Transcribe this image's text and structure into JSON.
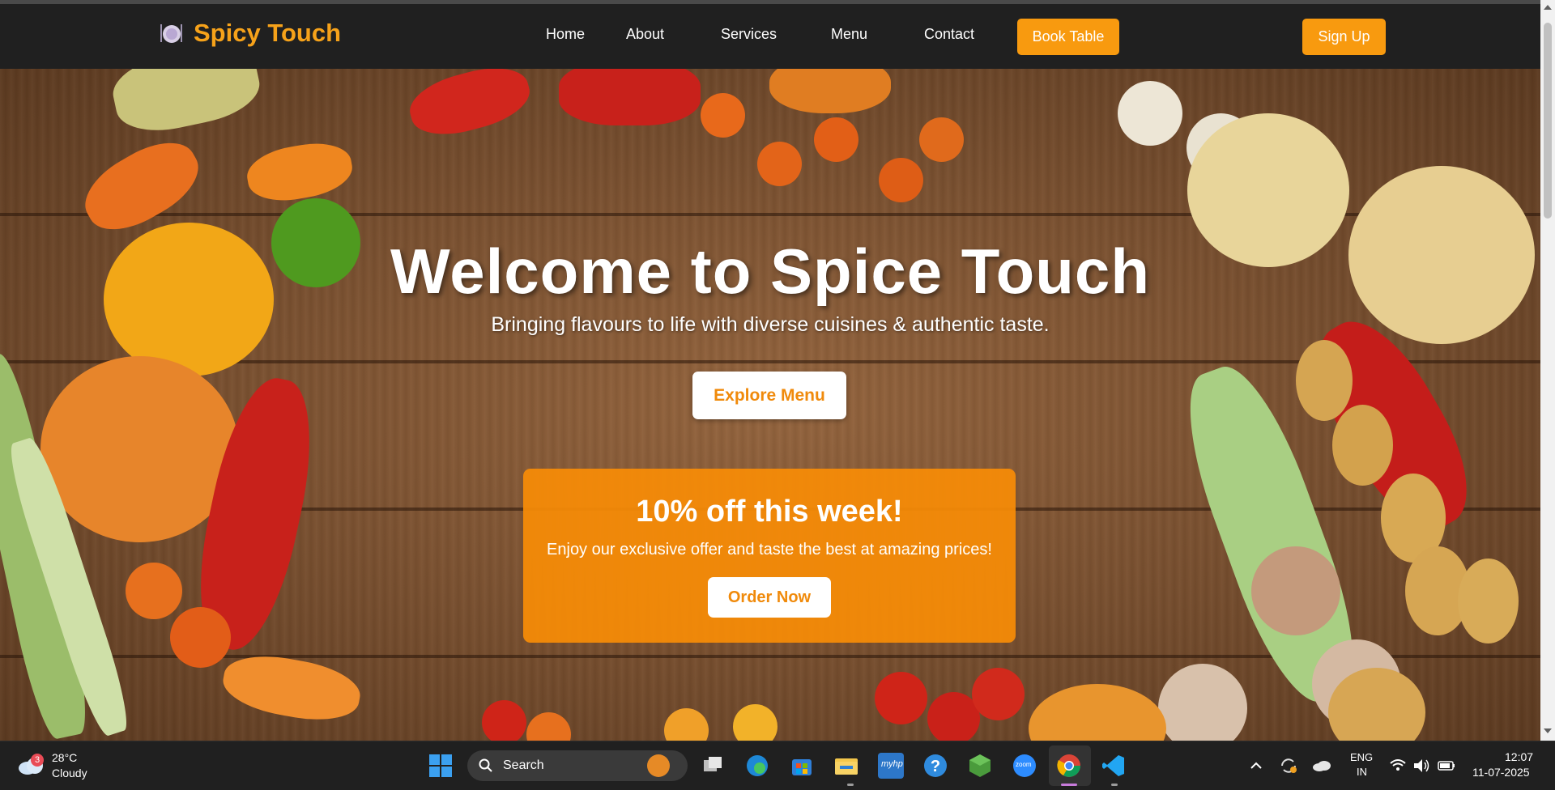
{
  "site": {
    "brand": "Spicy Touch",
    "nav": [
      "Home",
      "About",
      "Services",
      "Menu",
      "Contact"
    ],
    "book_table": "Book Table",
    "sign_up": "Sign Up",
    "accent_color": "#f89a0f"
  },
  "hero": {
    "title": "Welcome to Spice Touch",
    "subtitle": "Bringing flavours to life with diverse cuisines & authentic taste.",
    "explore_button": "Explore Menu"
  },
  "offer": {
    "title": "10% off this week!",
    "text": "Enjoy our exclusive offer and taste the best at amazing prices!",
    "button": "Order Now"
  },
  "taskbar": {
    "weather": {
      "badge": "3",
      "temp": "28°C",
      "condition": "Cloudy"
    },
    "search_label": "Search",
    "lang_line1": "ENG",
    "lang_line2": "IN",
    "time": "12:07",
    "date": "11-07-2025",
    "icons": [
      "windows-start-icon",
      "task-view-icon",
      "edge-icon",
      "store-icon",
      "file-explorer-icon",
      "myhp-icon",
      "help-icon",
      "cube-app-icon",
      "zoom-icon",
      "chrome-icon",
      "vscode-icon"
    ],
    "myhp_label": "myhp",
    "zoom_label": "zoom"
  }
}
